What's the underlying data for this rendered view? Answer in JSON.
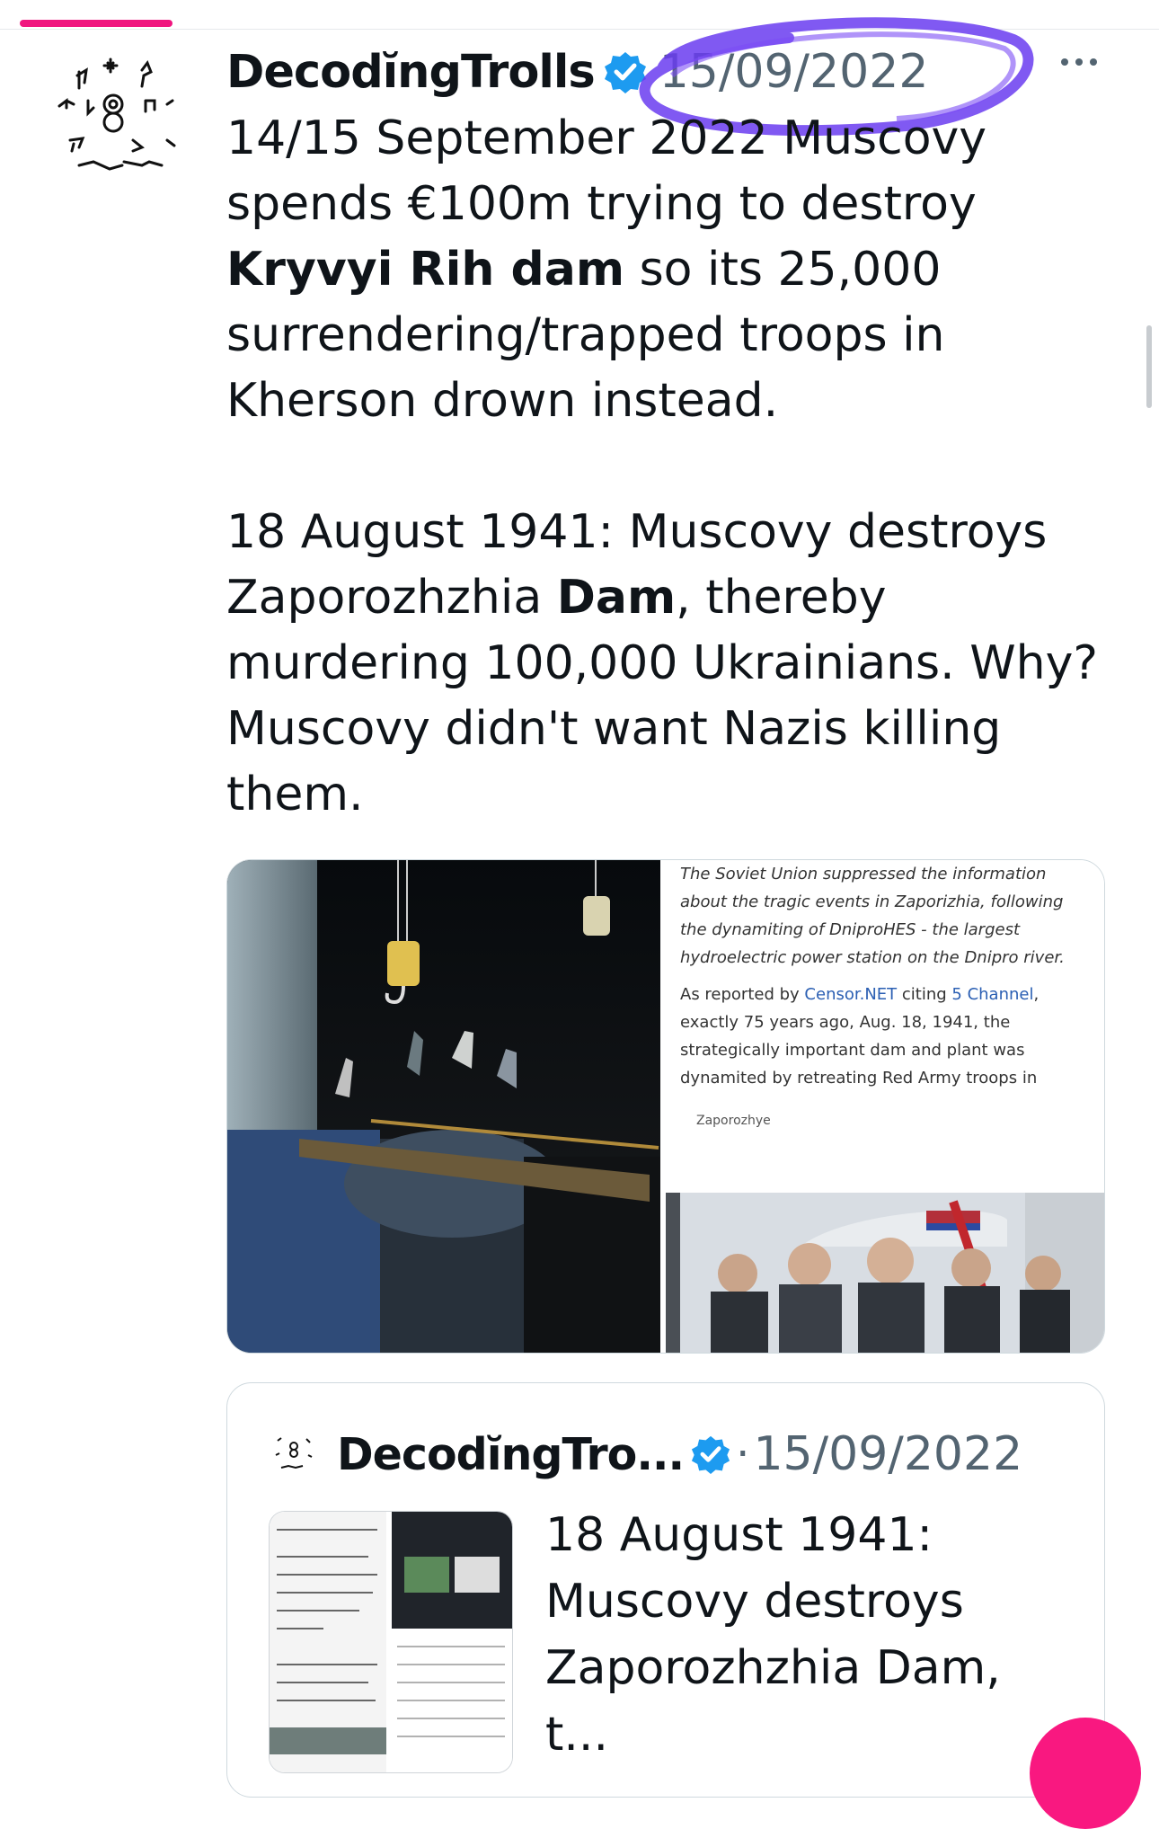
{
  "post": {
    "author": "DecodĭngTrolls",
    "date": "15/09/2022",
    "body_before_1": "14/15 September 2022 Muscovy spends €100m trying to destroy ",
    "body_bold_1": "Kryvyi Rih dam",
    "body_after_1": " so its 25,000 surrendering/trapped troops in Kherson drown instead.",
    "body_before_2": "18 August 1941: Muscovy destroys Zaporozhzhia ",
    "body_bold_2": "Dam",
    "body_after_2": ", thereby murdering 100,000 Ukrainians. Why? Muscovy didn't want Nazis killing them."
  },
  "media": {
    "article_para_1": "The Soviet Union suppressed the information about the tragic events in Zaporizhia, following the dynamiting of DniproHES - the largest hydroelectric power station on the Dnipro river.",
    "article_lead": "As reported by ",
    "article_link_1": "Censor.NET",
    "article_mid": " citing ",
    "article_link_2": "5 Channel",
    "article_rest": ", exactly 75 years ago, Aug. 18, 1941, the strategically important dam and plant was dynamited by retreating Red Army troops in",
    "article_caption": "Zaporozhye"
  },
  "quote": {
    "author": "DecodĭngTro...",
    "separator": "·",
    "date": "15/09/2022",
    "text": "18 August 1941: Muscovy destroys Zaporozhzhia Dam, t..."
  },
  "icons": [
    "verified-badge-icon",
    "more-options-icon"
  ],
  "colors": {
    "accent": "#f0157f",
    "verified": "#1d9bf0",
    "highlight": "#6a3cf0",
    "muted": "#536471"
  }
}
